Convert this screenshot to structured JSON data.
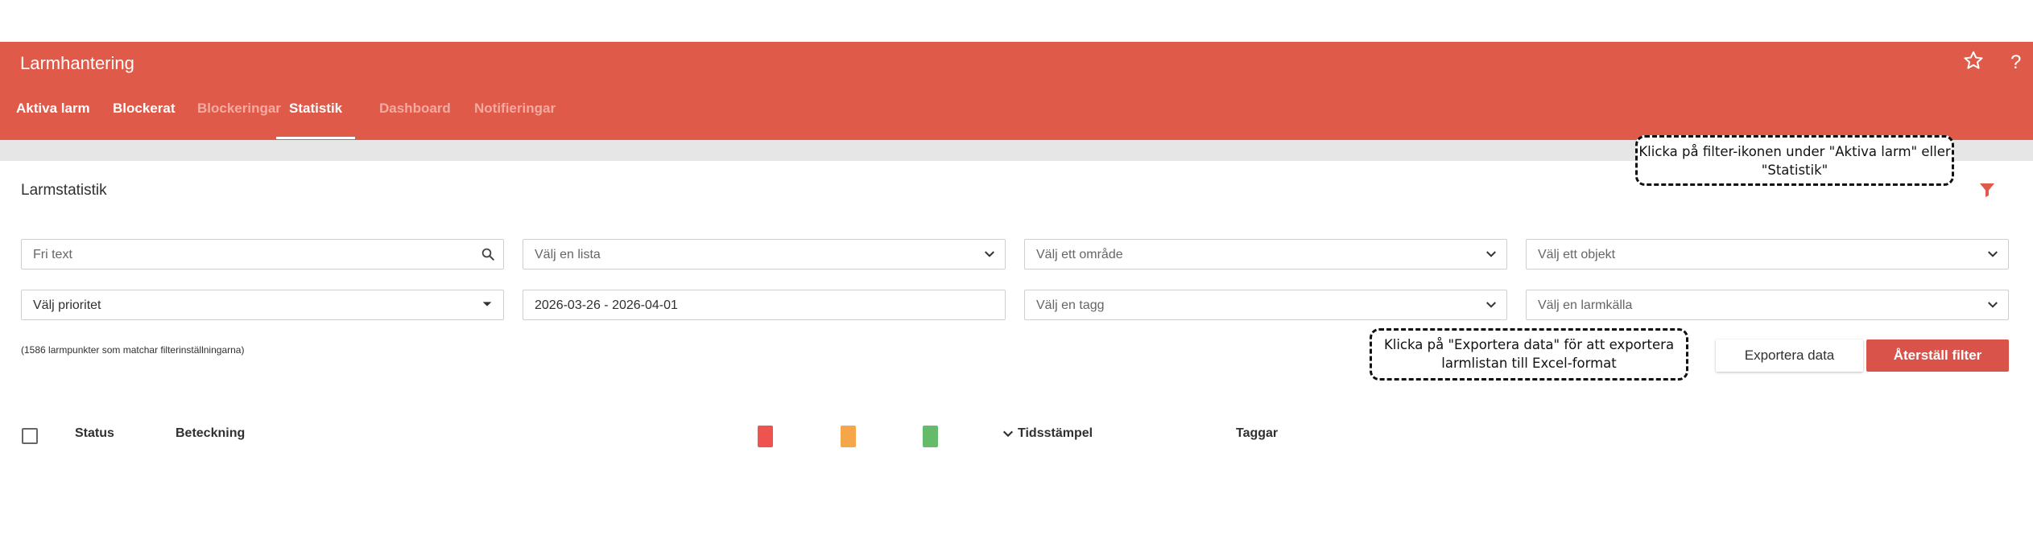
{
  "header": {
    "title": "Larmhantering",
    "favorite_icon": "star-icon",
    "help_label": "?",
    "bg_color": "#e05a4a"
  },
  "tabs": [
    {
      "label": "Aktiva larm",
      "state": "normal"
    },
    {
      "label": "Blockerat",
      "state": "normal"
    },
    {
      "label": "Blockeringar",
      "state": "dim"
    },
    {
      "label": "Statistik",
      "state": "active"
    },
    {
      "label": "Dashboard",
      "state": "dim"
    },
    {
      "label": "Notifieringar",
      "state": "dim"
    }
  ],
  "card": {
    "title": "Larmstatistik",
    "filter_icon": "filter-icon"
  },
  "filters": {
    "free_text_placeholder": "Fri text",
    "list_placeholder": "Välj en lista",
    "area_placeholder": "Välj ett område",
    "object_placeholder": "Välj ett objekt",
    "priority_placeholder": "Välj prioritet",
    "date_range": "2026-03-26 - 2026-04-01",
    "tag_placeholder": "Välj en tagg",
    "source_placeholder": "Välj en larmkälla"
  },
  "match_count": "(1586 larmpunkter som matchar filterinställningarna)",
  "callouts": {
    "filter_hint": "Klicka på filter-ikonen under \"Aktiva larm\" eller \"Statistik\"",
    "export_hint": "Klicka på \"Exportera data\" för att exportera larmlistan till Excel-format"
  },
  "buttons": {
    "export": "Exportera data",
    "reset": "Återställ filter"
  },
  "table": {
    "status": "Status",
    "designation": "Beteckning",
    "timestamp": "Tidsstämpel",
    "tags": "Taggar",
    "priority_colors": [
      "#ef5350",
      "#f5a54a",
      "#66bb6a"
    ]
  }
}
